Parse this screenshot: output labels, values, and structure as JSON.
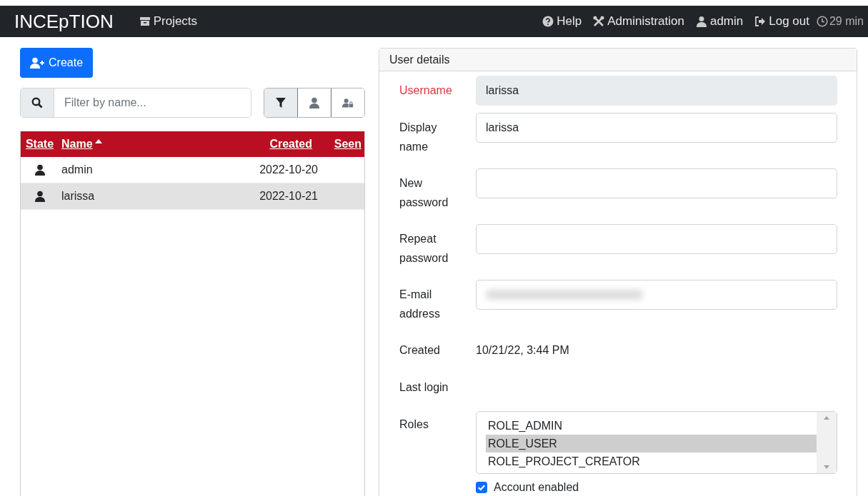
{
  "navbar": {
    "brand": "INCEpTION",
    "left_links": [
      {
        "kind": "projects",
        "label": "Projects"
      }
    ],
    "right_links": [
      {
        "kind": "help",
        "label": "Help"
      },
      {
        "kind": "admin",
        "label": "Administration"
      },
      {
        "kind": "user",
        "label": "admin"
      },
      {
        "kind": "logout",
        "label": "Log out"
      }
    ],
    "session_timer": "29 min"
  },
  "create_button": {
    "label": "Create"
  },
  "filter": {
    "placeholder": "Filter by name..."
  },
  "filter_toggles": [
    {
      "kind": "user",
      "selected": false
    },
    {
      "kind": "locked-user",
      "selected": false
    }
  ],
  "users_table": {
    "columns": [
      {
        "label": "State",
        "sorted": false
      },
      {
        "label": "Name",
        "sorted": true
      },
      {
        "label": "Created",
        "sorted": false
      },
      {
        "label": "Seen",
        "sorted": false
      }
    ],
    "rows": [
      {
        "enabled": true,
        "name": "admin",
        "created": "2022-10-20",
        "selected": false
      },
      {
        "enabled": true,
        "name": "larissa",
        "created": "2022-10-21",
        "selected": true
      }
    ]
  },
  "user_details": {
    "title": "User details",
    "fields": [
      {
        "kind": "input",
        "label": "Username",
        "value": "larissa",
        "disabled": true,
        "error": true
      },
      {
        "kind": "input",
        "label": "Display name",
        "value": "larissa",
        "disabled": false,
        "error": false
      },
      {
        "kind": "input",
        "label": "New password",
        "disabled": false,
        "error": false
      },
      {
        "kind": "input",
        "label": "Repeat password",
        "disabled": false,
        "error": false
      },
      {
        "kind": "input",
        "label": "E-mail address",
        "redacted": true,
        "disabled": false,
        "error": false
      },
      {
        "kind": "text",
        "label": "Created",
        "value": "10/21/22, 3:44 PM"
      },
      {
        "kind": "text",
        "label": "Last login"
      },
      {
        "kind": "listbox",
        "label": "Roles",
        "options": [
          {
            "label": "ROLE_ADMIN",
            "selected": false
          },
          {
            "label": "ROLE_USER",
            "selected": true
          },
          {
            "label": "ROLE_PROJECT_CREATOR",
            "selected": false
          }
        ]
      }
    ],
    "account_enabled": {
      "label": "Account enabled",
      "checked": true
    }
  }
}
